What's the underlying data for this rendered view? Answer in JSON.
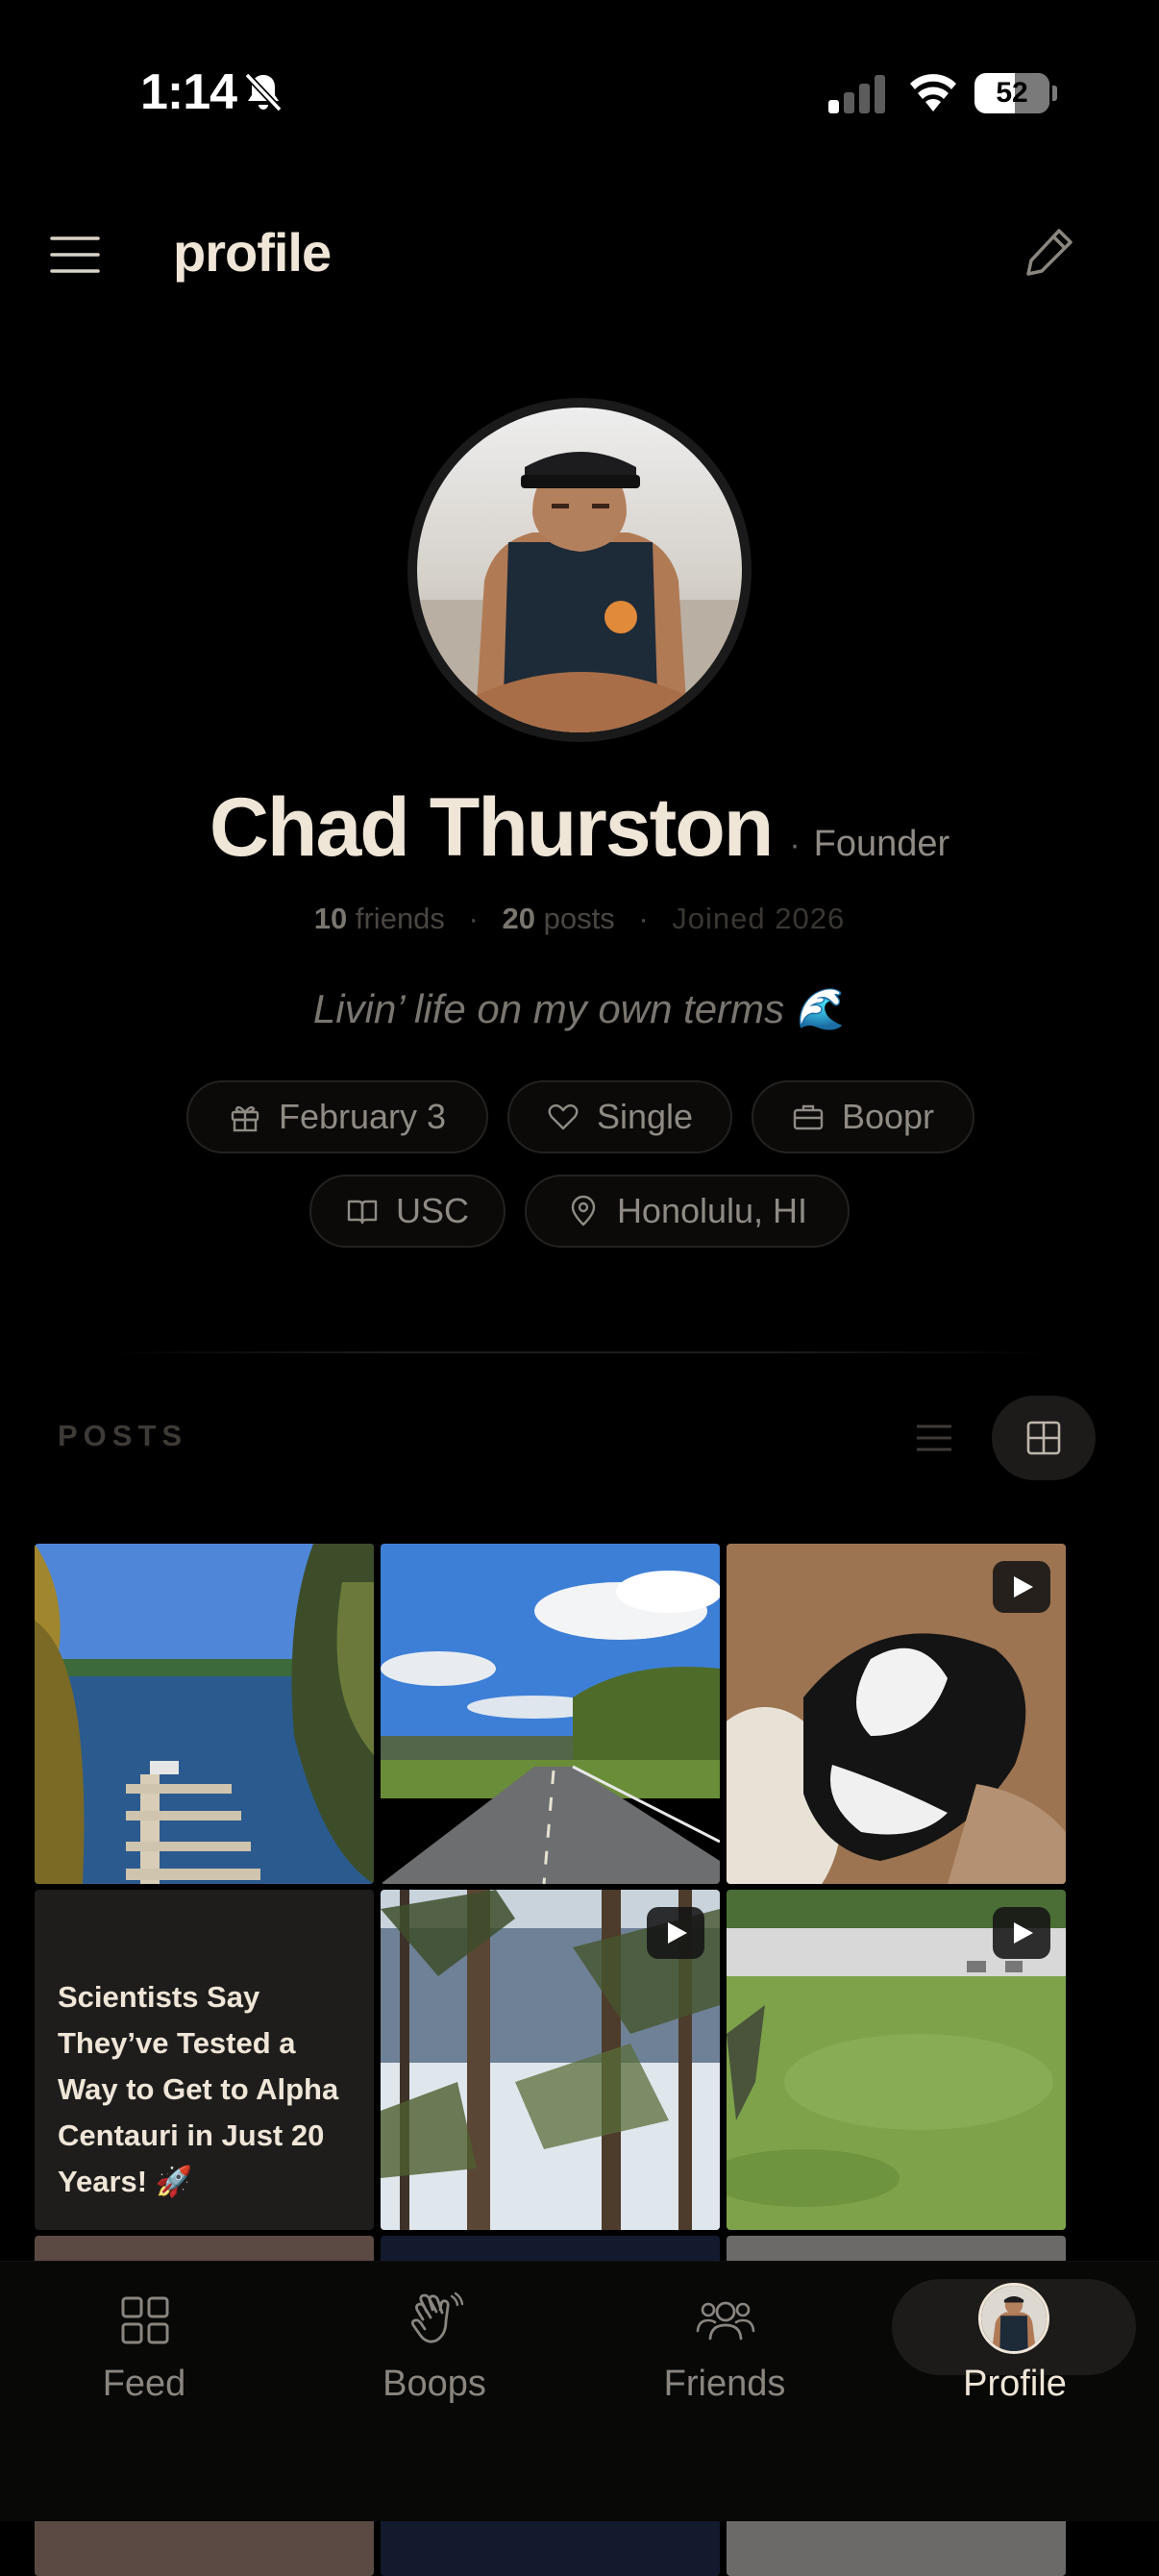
{
  "status_bar": {
    "time": "1:14",
    "battery": "52"
  },
  "header": {
    "title": "profile"
  },
  "profile": {
    "name": "Chad Thurston",
    "role": "Founder",
    "friends_count": "10",
    "friends_label": "friends",
    "posts_count": "20",
    "posts_label": "posts",
    "joined": "Joined 2026",
    "bio": "Livin’ life on my own terms 🌊"
  },
  "chips": [
    {
      "icon": "gift-icon",
      "label": "February 3"
    },
    {
      "icon": "heart-icon",
      "label": "Single"
    },
    {
      "icon": "briefcase-icon",
      "label": "Boopr"
    },
    {
      "icon": "book-icon",
      "label": "USC"
    },
    {
      "icon": "location-pin-icon",
      "label": "Honolulu, HI"
    }
  ],
  "posts_section": {
    "label": "POSTS",
    "view_mode": "grid"
  },
  "posts": [
    {
      "type": "photo",
      "subject": "lake dock"
    },
    {
      "type": "photo",
      "subject": "open road"
    },
    {
      "type": "video",
      "subject": "cat"
    },
    {
      "type": "text",
      "text": "Scientists Say They’ve Tested a Way to Get to Alpha Centauri in Just 20 Years! 🚀"
    },
    {
      "type": "video",
      "subject": "pine trees"
    },
    {
      "type": "video",
      "subject": "backyard lawn"
    }
  ],
  "tabbar": {
    "tabs": [
      {
        "label": "Feed",
        "icon": "grid-icon"
      },
      {
        "label": "Boops",
        "icon": "waving-hand-icon"
      },
      {
        "label": "Friends",
        "icon": "people-icon"
      },
      {
        "label": "Profile",
        "icon": "avatar"
      }
    ],
    "active": "Profile"
  },
  "colors": {
    "background": "#000000",
    "text_primary": "#efe6d8",
    "text_muted": "#8f8a84",
    "chip_border": "#242220",
    "active_pill": "#1c1b1a"
  }
}
